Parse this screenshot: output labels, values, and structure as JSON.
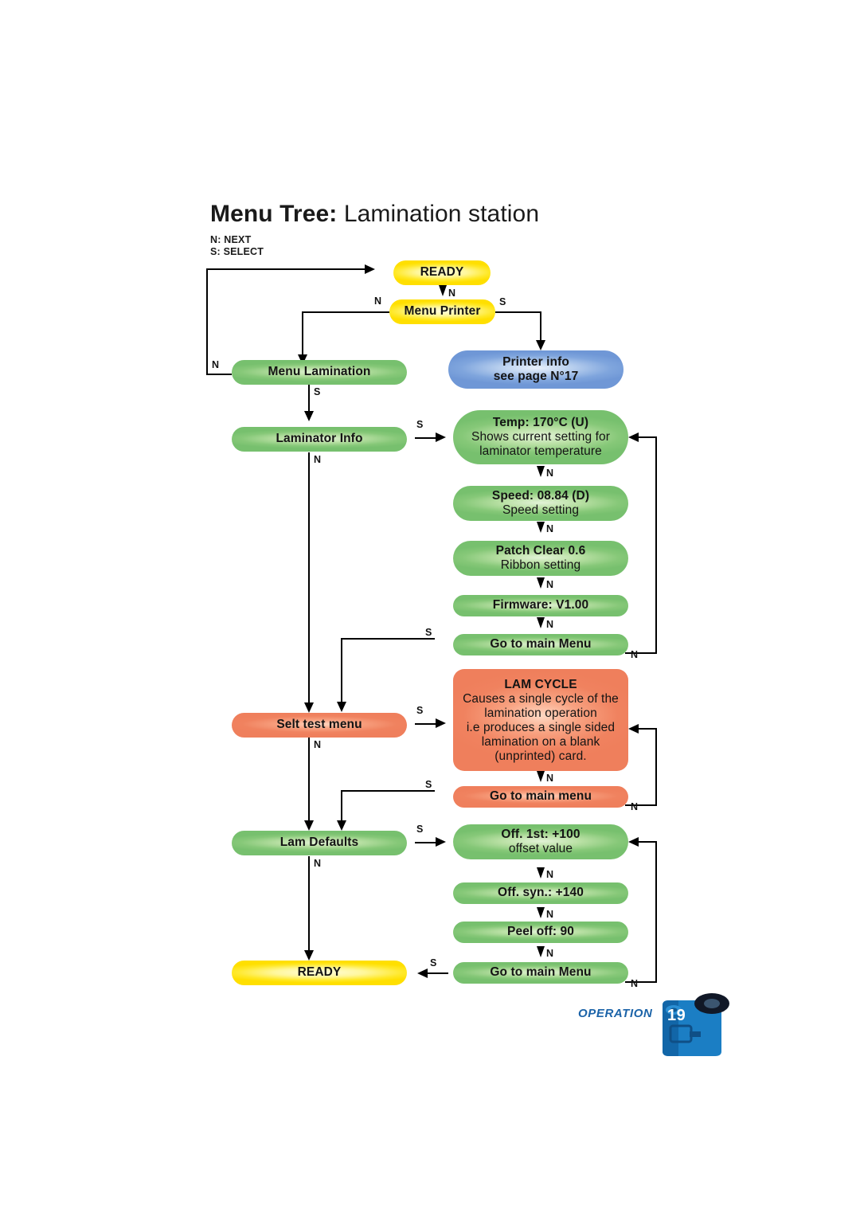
{
  "title": {
    "bold": "Menu Tree:",
    "light": "Lamination station"
  },
  "legend": {
    "next": "N: NEXT",
    "select": "S: SELECT"
  },
  "colors": {
    "yellow": "#ffdf00",
    "green": "#77c06e",
    "blue": "#6f97d6",
    "orange": "#ef7f5c",
    "line": "#000000",
    "page_accent": "#1b63a8"
  },
  "nodes": {
    "ready_top": {
      "title": "READY",
      "color": "yellow"
    },
    "menu_printer": {
      "title": "Menu Printer",
      "color": "yellow"
    },
    "menu_lamination": {
      "title": "Menu Lamination",
      "color": "green"
    },
    "printer_info": {
      "title": "Printer info",
      "sub": "see page N°17",
      "color": "blue"
    },
    "laminator_info": {
      "title": "Laminator Info",
      "color": "green"
    },
    "temp": {
      "title": "Temp: 170°C (U)",
      "sub1": "Shows current setting for",
      "sub2": "laminator temperature",
      "color": "green"
    },
    "speed": {
      "title": "Speed: 08.84 (D)",
      "sub": "Speed setting",
      "color": "green"
    },
    "patch": {
      "title": "Patch Clear 0.6",
      "sub": "Ribbon setting",
      "color": "green"
    },
    "firmware": {
      "title": "Firmware: V1.00",
      "color": "green"
    },
    "goto_main_menu_1": {
      "title": "Go to main Menu",
      "color": "green"
    },
    "self_test": {
      "title": "Selt test menu",
      "color": "orange"
    },
    "lam_cycle": {
      "title": "LAM CYCLE",
      "sub1": "Causes a single cycle of the",
      "sub2": "lamination operation",
      "sub3": "i.e produces a single sided",
      "sub4": "lamination on a blank",
      "sub5": "(unprinted) card.",
      "color": "orange"
    },
    "goto_main_menu_2": {
      "title": "Go to main menu",
      "color": "orange"
    },
    "lam_defaults": {
      "title": "Lam Defaults",
      "color": "green"
    },
    "off_1st": {
      "title": "Off. 1st: +100",
      "sub": "offset value",
      "color": "green"
    },
    "off_syn": {
      "title": "Off. syn.: +140",
      "color": "green"
    },
    "peel_off": {
      "title": "Peel off: 90",
      "color": "green"
    },
    "goto_main_menu_3": {
      "title": "Go to main Menu",
      "color": "green"
    },
    "ready_bottom": {
      "title": "READY",
      "color": "yellow"
    }
  },
  "edges": {
    "ready_to_menu_printer": "N",
    "menu_printer_to_lamination": "N",
    "menu_printer_to_printer_info": "S",
    "lamination_loop_back": "N",
    "lamination_to_laminator_info": "S",
    "laminator_info_to_temp": "S",
    "laminator_info_next": "N",
    "temp_to_speed": "N",
    "speed_to_patch": "N",
    "patch_to_firmware": "N",
    "firmware_to_goto1": "N",
    "goto1_return": "N",
    "goto1_select": "S",
    "self_test_to_lam_cycle": "S",
    "self_test_next": "N",
    "lam_cycle_to_goto2": "N",
    "goto2_return": "N",
    "goto2_select": "S",
    "lam_defaults_to_off1st": "S",
    "lam_defaults_next": "N",
    "off1st_to_offsyn": "N",
    "offsyn_to_peel": "N",
    "peel_to_goto3": "N",
    "goto3_return": "N",
    "goto3_select": "S"
  },
  "footer": {
    "section": "OPERATION",
    "page": "19",
    "icon": "ribbon-cartridge-icon"
  }
}
